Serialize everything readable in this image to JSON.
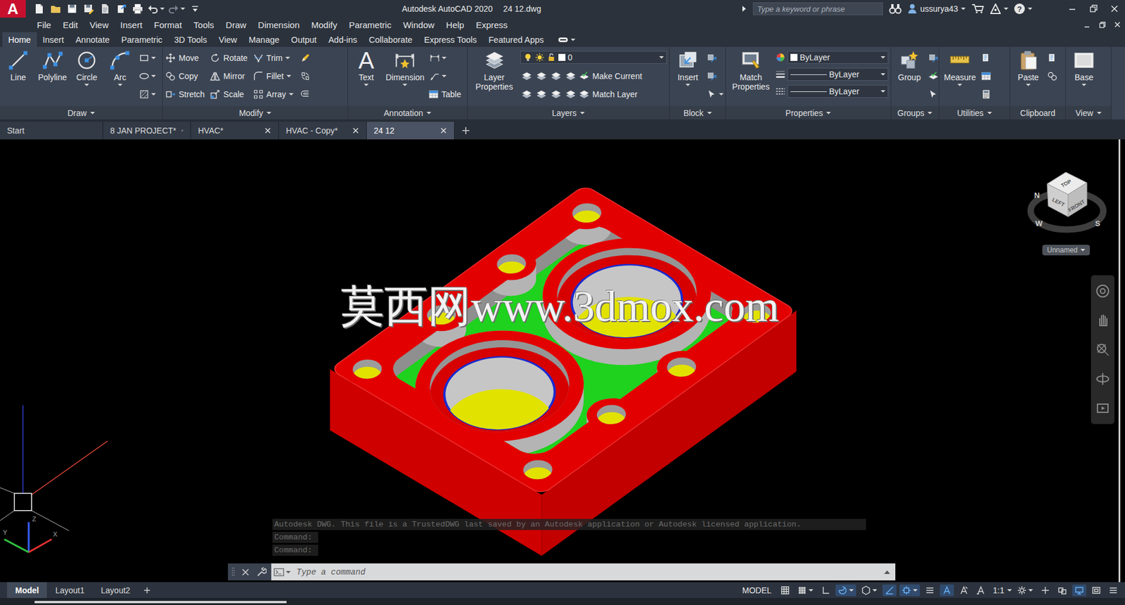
{
  "window": {
    "title": "Autodesk AutoCAD 2020",
    "file": "24 12.dwg"
  },
  "logo": {
    "letter": "A"
  },
  "search": {
    "placeholder": "Type a keyword or phrase"
  },
  "user": {
    "name": "ussurya43"
  },
  "help": {
    "icon": "?"
  },
  "menu": [
    "File",
    "Edit",
    "View",
    "Insert",
    "Format",
    "Tools",
    "Draw",
    "Dimension",
    "Modify",
    "Parametric",
    "Window",
    "Help",
    "Express"
  ],
  "ribbon_tabs": [
    {
      "label": "Home",
      "selected": true
    },
    {
      "label": "Insert",
      "selected": false
    },
    {
      "label": "Annotate",
      "selected": false
    },
    {
      "label": "Parametric",
      "selected": false
    },
    {
      "label": "3D Tools",
      "selected": false
    },
    {
      "label": "View",
      "selected": false
    },
    {
      "label": "Manage",
      "selected": false
    },
    {
      "label": "Output",
      "selected": false
    },
    {
      "label": "Add-ins",
      "selected": false
    },
    {
      "label": "Collaborate",
      "selected": false
    },
    {
      "label": "Express Tools",
      "selected": false
    },
    {
      "label": "Featured Apps",
      "selected": false
    }
  ],
  "ribbon": {
    "draw": {
      "title": "Draw",
      "menu": true,
      "tools": [
        "Line",
        "Polyline",
        "Circle",
        "Arc"
      ]
    },
    "modify": {
      "title": "Modify",
      "menu": true,
      "tools": [
        "Move",
        "Rotate",
        "Trim",
        "Copy",
        "Mirror",
        "Fillet",
        "Stretch",
        "Scale",
        "Array"
      ]
    },
    "annotation": {
      "title": "Annotation",
      "menu": true,
      "text_icon": "A",
      "tools": [
        "Text",
        "Dimension",
        "Table"
      ]
    },
    "layers": {
      "title": "Layers",
      "menu": true,
      "tools": [
        "Layer Properties",
        "Make Current",
        "Match Layer"
      ],
      "current_layer": "0"
    },
    "block": {
      "title": "Block",
      "menu": true,
      "tools": [
        "Insert"
      ]
    },
    "properties": {
      "title": "Properties",
      "menu": true,
      "tools": [
        "Match Properties"
      ],
      "color": "ByLayer",
      "lineweight": "ByLayer",
      "linetype": "ByLayer"
    },
    "groups": {
      "title": "Groups",
      "menu": true,
      "tools": [
        "Group"
      ]
    },
    "utilities": {
      "title": "Utilities",
      "menu": true,
      "tools": [
        "Measure"
      ]
    },
    "clipboard": {
      "title": "Clipboard",
      "menu": false,
      "tools": [
        "Paste"
      ]
    },
    "view": {
      "title": "View",
      "menu": true,
      "tools": [
        "Base"
      ]
    }
  },
  "file_tabs": [
    {
      "label": "Start",
      "selected": false,
      "closable": false
    },
    {
      "label": "8 JAN PROJECT*",
      "selected": false,
      "closable": true
    },
    {
      "label": "HVAC*",
      "selected": false,
      "closable": true
    },
    {
      "label": "HVAC - Copy*",
      "selected": false,
      "closable": true
    },
    {
      "label": "24 12",
      "selected": true,
      "closable": true
    }
  ],
  "watermark": "莫西网www.3dmox.com",
  "viewcube": {
    "top": "TOP",
    "left": "LEFT",
    "front": "FRONT",
    "north": "N",
    "west": "W",
    "south": "S",
    "view_name": "Unnamed"
  },
  "ucs": {
    "x": "X",
    "y": "Y",
    "z": "Z"
  },
  "command": {
    "history": [
      "Autodesk DWG.  This file is a TrustedDWG last saved by an Autodesk application or Autodesk licensed application.",
      "Command:",
      "Command:"
    ],
    "placeholder": "Type a command"
  },
  "layout_tabs": [
    {
      "label": "Model",
      "selected": true
    },
    {
      "label": "Layout1",
      "selected": false
    },
    {
      "label": "Layout2",
      "selected": false
    }
  ],
  "status": {
    "space": "MODEL",
    "scale": "1:1",
    "toggles_a": [
      {
        "on": false,
        "menu": false
      },
      {
        "on": false,
        "menu": true
      },
      {
        "on": false,
        "menu": false
      },
      {
        "on": true,
        "menu": true
      },
      {
        "on": false,
        "menu": true
      },
      {
        "on": true,
        "menu": false
      },
      {
        "on": true,
        "menu": true
      },
      {
        "on": false,
        "menu": false
      },
      {
        "on": true,
        "menu": false
      },
      {
        "on": false,
        "menu": false
      },
      {
        "on": false,
        "menu": false
      }
    ],
    "toggles_b": [
      {
        "on": false,
        "menu": true
      },
      {
        "on": false,
        "menu": false
      },
      {
        "on": false,
        "menu": false
      },
      {
        "on": true,
        "menu": false
      },
      {
        "on": false,
        "menu": false
      },
      {
        "on": false,
        "menu": false
      }
    ]
  }
}
